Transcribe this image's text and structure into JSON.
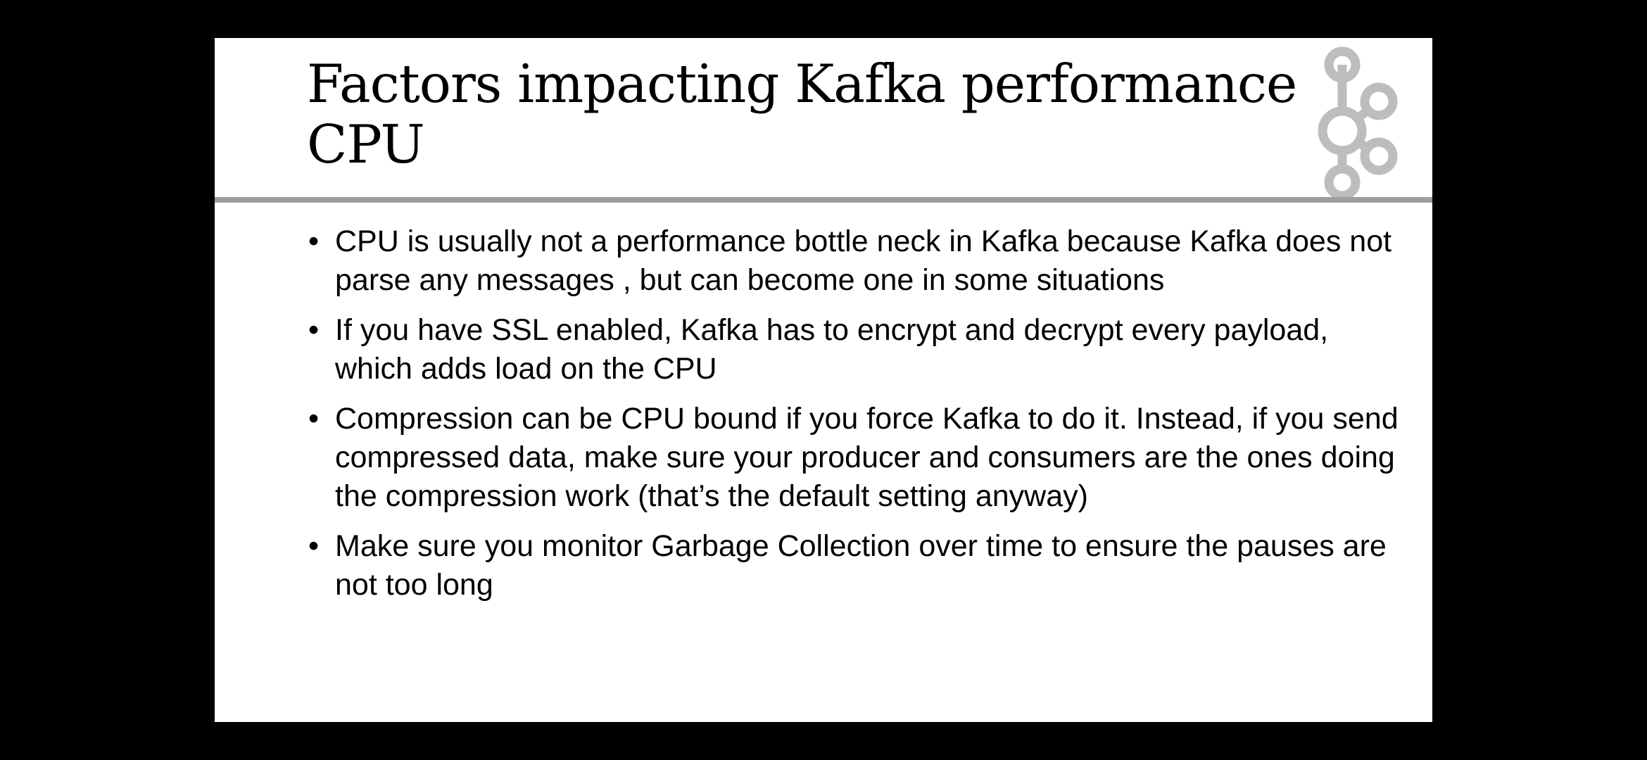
{
  "slide": {
    "title_line_1": "Factors impacting Kafka performance",
    "title_line_2": "CPU",
    "logo_icon": "kafka-logo-icon",
    "bullet_glyph": "•",
    "bullets": [
      "CPU is usually not a performance bottle neck in Kafka because Kafka does not parse any messages , but can become one in some situations",
      "If you have SSL enabled, Kafka has to encrypt and decrypt every payload, which adds load on the CPU",
      "Compression can be CPU bound if you force Kafka to do it. Instead, if you send compressed data, make sure your producer and consumers are the ones doing the compression work (that’s the default setting anyway)",
      "Make sure you monitor Garbage Collection over time to ensure the pauses are not too long"
    ]
  },
  "colors": {
    "background": "#000000",
    "slide": "#ffffff",
    "rule": "#9e9e9e",
    "logo": "#bdbdbd",
    "text": "#000000"
  }
}
